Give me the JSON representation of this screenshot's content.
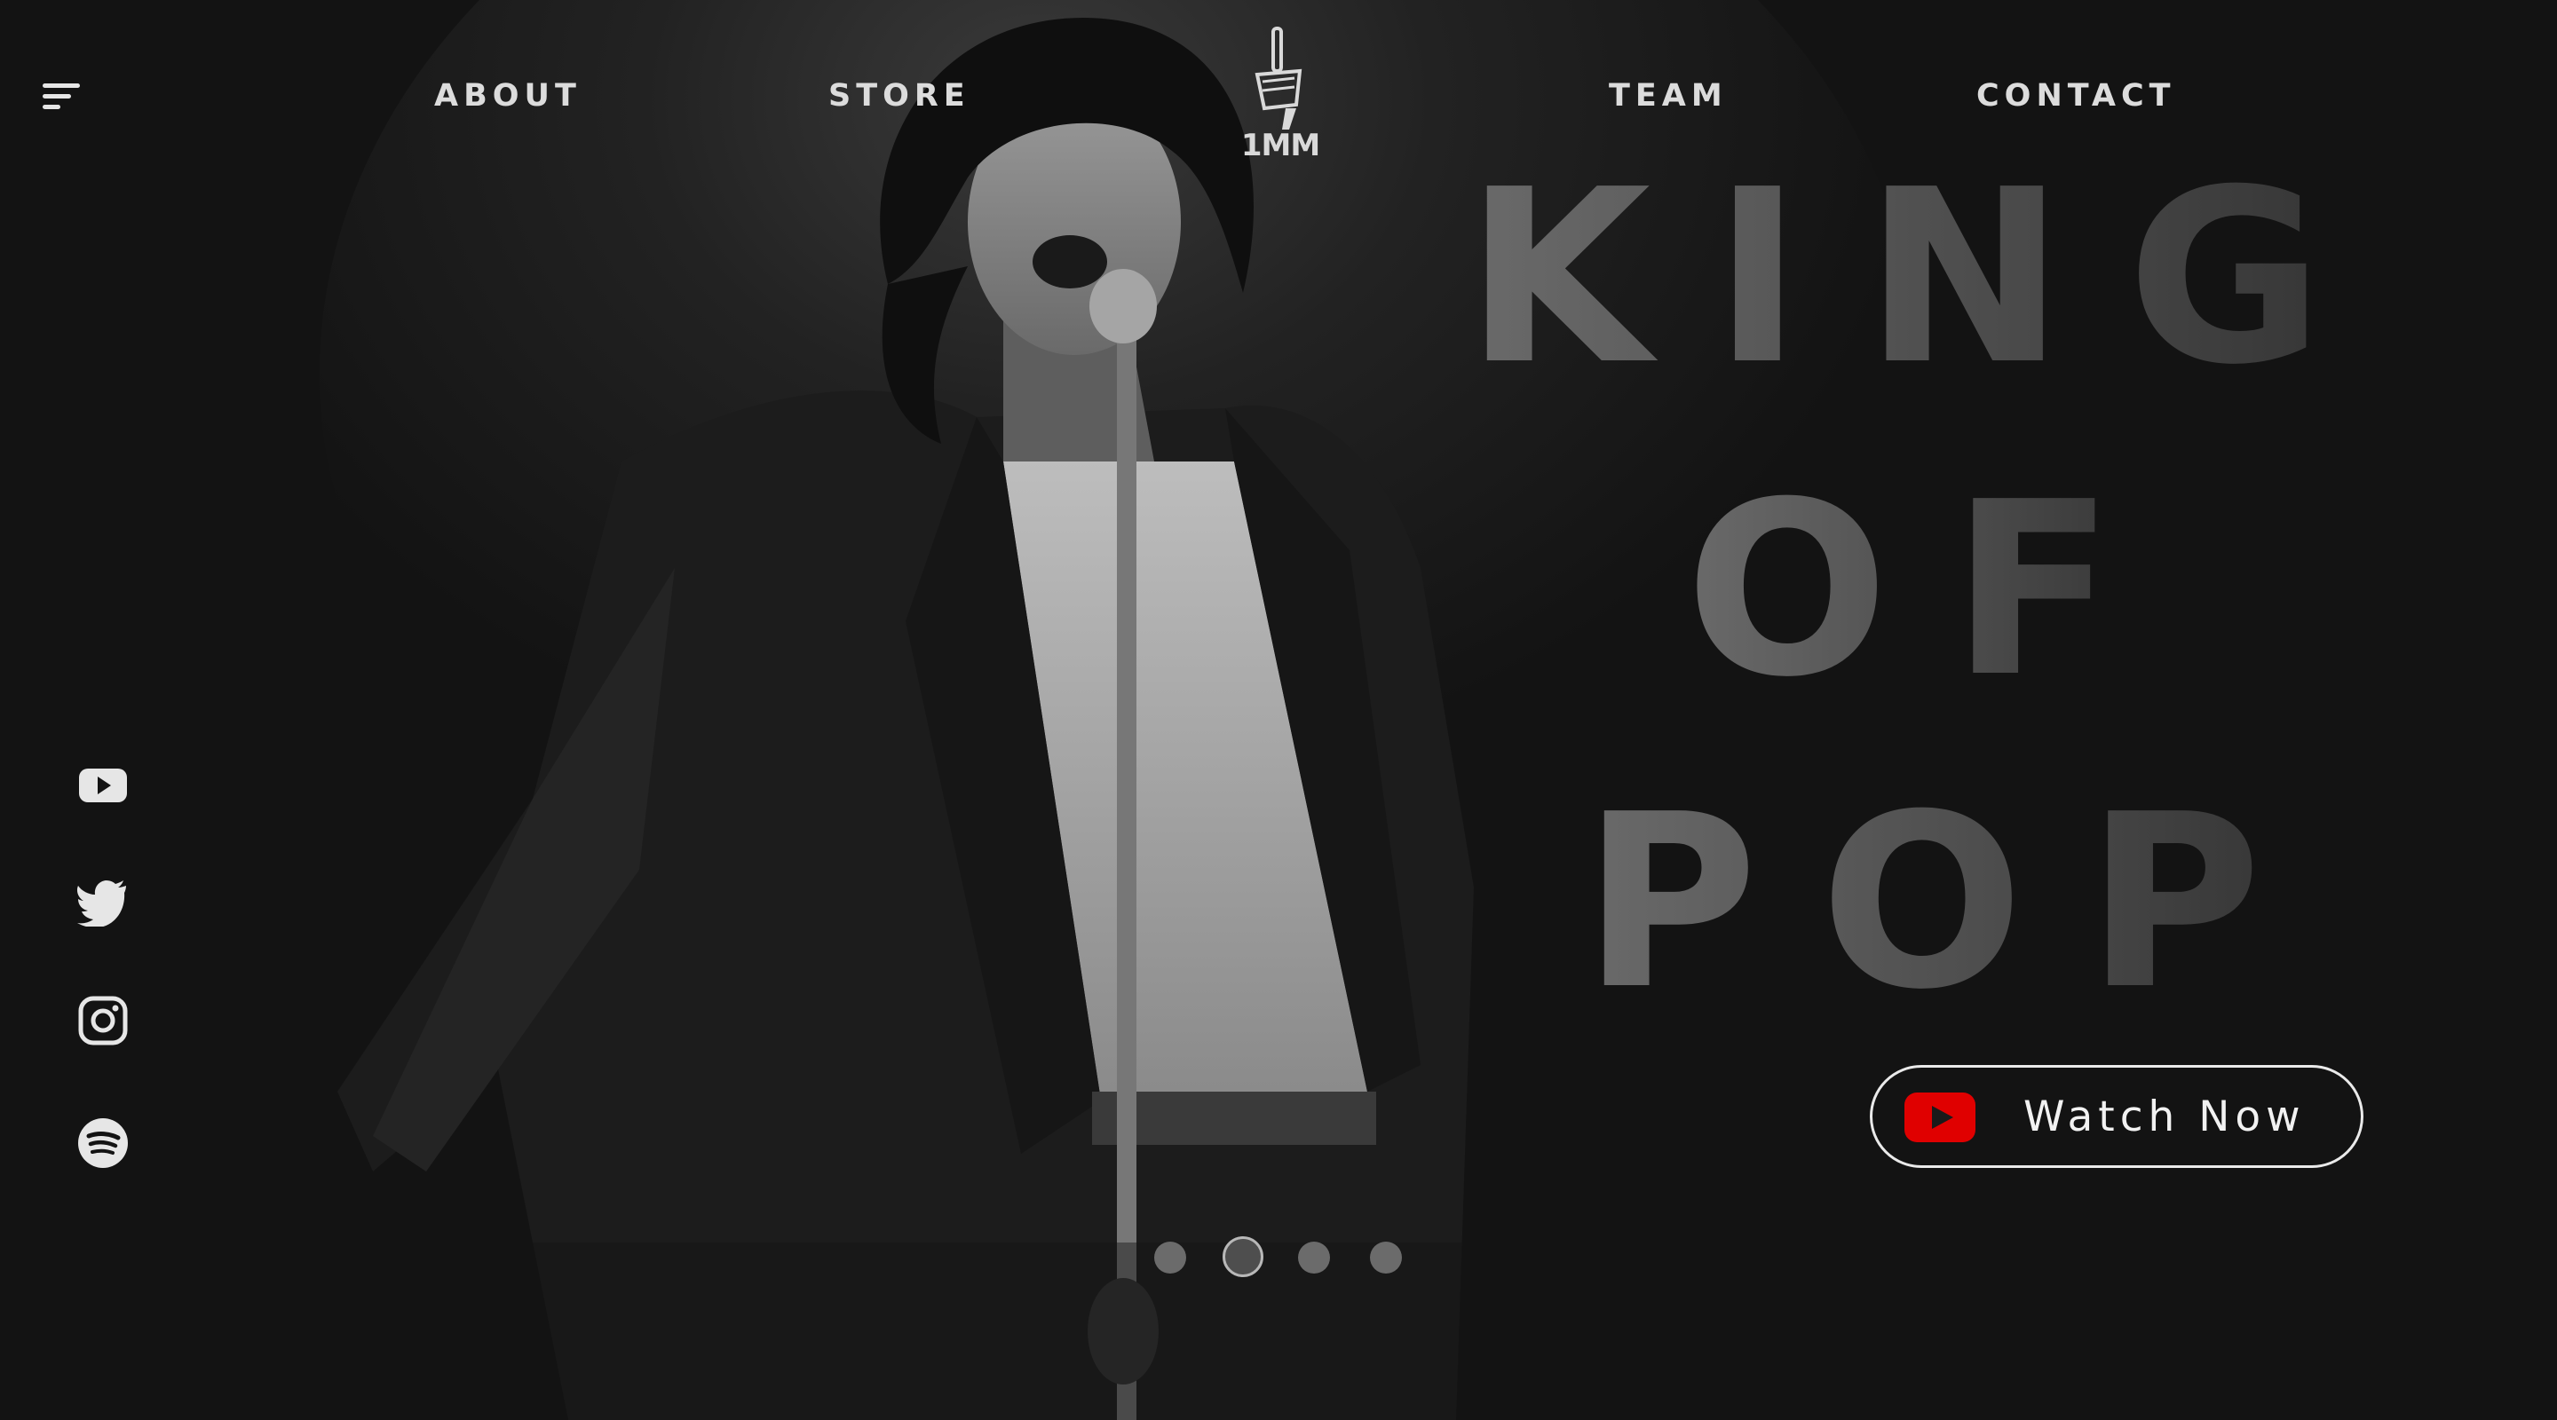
{
  "nav": {
    "about": "ABOUT",
    "store": "STORE",
    "team": "TEAM",
    "contact": "CONTACT"
  },
  "logo": {
    "text": "1MM"
  },
  "hero": {
    "headline": [
      "KING",
      "OF",
      "POP"
    ],
    "image": "performer-singing-photo",
    "button_label": "Watch Now",
    "button_icon": "youtube-play-icon"
  },
  "social": [
    {
      "name": "youtube-icon"
    },
    {
      "name": "twitter-icon"
    },
    {
      "name": "instagram-icon"
    },
    {
      "name": "spotify-icon"
    }
  ],
  "slider": {
    "total": 4,
    "active": 2
  },
  "colors": {
    "background": "#131313",
    "text": "#dcdcdc",
    "headline": "#555555",
    "youtube_red": "#e00000"
  }
}
